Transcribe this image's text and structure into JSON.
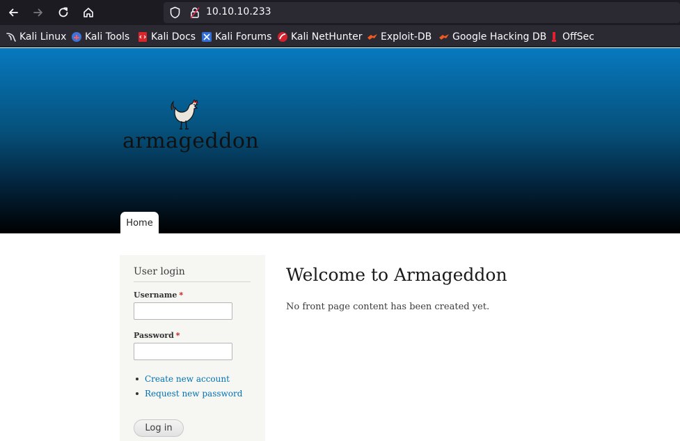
{
  "browser": {
    "url": "10.10.10.233",
    "icons": {
      "back": "back-arrow-icon",
      "forward": "forward-arrow-icon",
      "reload": "reload-icon",
      "home": "home-icon",
      "tracking": "shield-icon",
      "security": "lock-icon"
    },
    "bookmarks": [
      {
        "label": "Kali Linux",
        "icon": "kali-dragon-icon"
      },
      {
        "label": "Kali Tools",
        "icon": "kali-tools-icon"
      },
      {
        "label": "Kali Docs",
        "icon": "kali-docs-icon"
      },
      {
        "label": "Kali Forums",
        "icon": "kali-forums-icon"
      },
      {
        "label": "Kali NetHunter",
        "icon": "nethunter-icon"
      },
      {
        "label": "Exploit-DB",
        "icon": "exploit-db-icon"
      },
      {
        "label": "Google Hacking DB",
        "icon": "ghdb-icon"
      },
      {
        "label": "OffSec",
        "icon": "offsec-icon"
      }
    ]
  },
  "site": {
    "logo_text": "armageddon",
    "nav": {
      "home": "Home"
    }
  },
  "login": {
    "title": "User login",
    "username_label": "Username",
    "password_label": "Password",
    "required_mark": "*",
    "username_value": "",
    "password_value": "",
    "links": [
      "Create new account",
      "Request new password"
    ],
    "submit_label": "Log in"
  },
  "main": {
    "heading": "Welcome to Armageddon",
    "message": "No front page content has been created yet."
  },
  "colors": {
    "header_top": "#0779bf",
    "header_bottom": "#000000",
    "link": "#0071b3",
    "sidebar_bg": "#f6f6f2",
    "required": "#cc1111"
  }
}
